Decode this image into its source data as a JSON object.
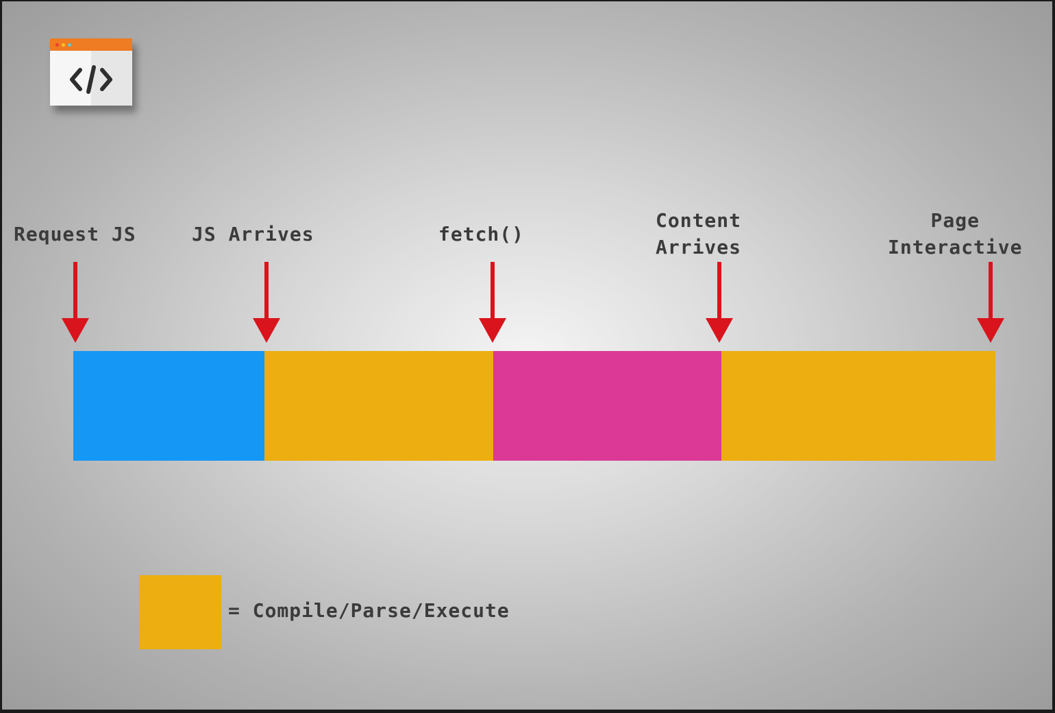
{
  "colors": {
    "blue": "#1497f5",
    "orange": "#ecae10",
    "magenta": "#db3995",
    "arrow_red": "#d9141c",
    "text": "#3b3b3b"
  },
  "icons": {
    "browser_code": "code-window-icon",
    "code_glyph": "</>"
  },
  "markers": [
    {
      "label": "Request JS"
    },
    {
      "label": "JS Arrives"
    },
    {
      "label": "fetch()"
    },
    {
      "label": "Content\nArrives"
    },
    {
      "label": "Page\nInteractive"
    }
  ],
  "segments": [
    {
      "color": "#1497f5"
    },
    {
      "color": "#ecae10"
    },
    {
      "color": "#db3995"
    },
    {
      "color": "#ecae10"
    }
  ],
  "legend": {
    "color": "#ecae10",
    "label": "= Compile/Parse/Execute"
  }
}
